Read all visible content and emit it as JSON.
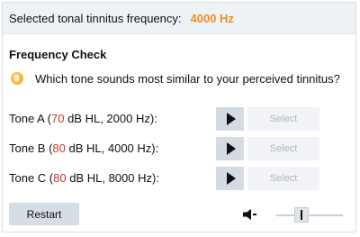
{
  "header": {
    "label": "Selected tonal tinnitus frequency:",
    "frequency": "4000 Hz"
  },
  "section_title": "Frequency Check",
  "question": "Which tone sounds most similar to your perceived tinnitus?",
  "question_icon": "hand-icon",
  "tones": [
    {
      "name": "Tone A",
      "prefix": "Tone A (",
      "level": "70",
      "suffix": " dB HL, 2000 Hz):",
      "play_icon": "play-icon",
      "select_label": "Select"
    },
    {
      "name": "Tone B",
      "prefix": "Tone B (",
      "level": "80",
      "suffix": " dB HL, 4000 Hz):",
      "play_icon": "play-icon",
      "select_label": "Select"
    },
    {
      "name": "Tone C",
      "prefix": "Tone C (",
      "level": "80",
      "suffix": " dB HL, 8000 Hz):",
      "play_icon": "play-icon",
      "select_label": "Select"
    }
  ],
  "restart_label": "Restart",
  "volume": {
    "icon": "speaker-icon",
    "level": 0.35
  },
  "colors": {
    "frequency_accent": "#f08b1d",
    "level_accent": "#c0392b",
    "header_bg": "#edf2f7",
    "button_bg": "#d5dbe2"
  }
}
